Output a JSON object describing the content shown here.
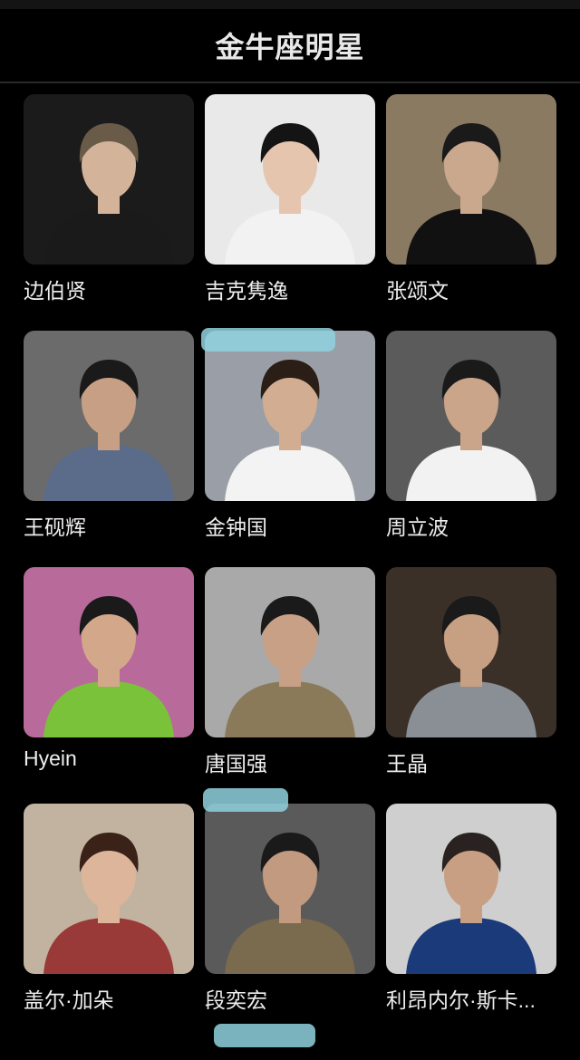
{
  "header": {
    "title": "金牛座明星"
  },
  "celebrities": [
    {
      "name": "边伯贤",
      "bg": "#1b1b1b",
      "skin": "#d3b39a",
      "hair": "#6a5b48",
      "top": "#1a1a1a"
    },
    {
      "name": "吉克隽逸",
      "bg": "#e9e9e9",
      "skin": "#e6c5ae",
      "hair": "#141414",
      "top": "#f2f2f2"
    },
    {
      "name": "张颂文",
      "bg": "#8a7a62",
      "skin": "#c9a88e",
      "hair": "#1a1a1a",
      "top": "#111111"
    },
    {
      "name": "王砚辉",
      "bg": "#6b6b6b",
      "skin": "#c79f84",
      "hair": "#1a1a1a",
      "top": "#5a6c8a"
    },
    {
      "name": "金钟国",
      "bg": "#9a9ea6",
      "skin": "#d2ad92",
      "hair": "#2a1e16",
      "top": "#f3f3f3"
    },
    {
      "name": "周立波",
      "bg": "#5b5b5b",
      "skin": "#caa58a",
      "hair": "#1a1a1a",
      "top": "#f2f2f2"
    },
    {
      "name": "Hyein",
      "bg": "#b86a9a",
      "skin": "#d3a88a",
      "hair": "#1a1a1a",
      "top": "#7ac23a"
    },
    {
      "name": "唐国强",
      "bg": "#a9a9a9",
      "skin": "#c8a085",
      "hair": "#1a1a1a",
      "top": "#8a7a5a"
    },
    {
      "name": "王晶",
      "bg": "#3a3028",
      "skin": "#c7a083",
      "hair": "#1a1a1a",
      "top": "#8a8f96"
    },
    {
      "name": "盖尔·加朵",
      "bg": "#c2b3a0",
      "skin": "#dcb59a",
      "hair": "#3a2218",
      "top": "#9a3a38"
    },
    {
      "name": "段奕宏",
      "bg": "#5a5a5a",
      "skin": "#c29a7f",
      "hair": "#1a1a1a",
      "top": "#7a6a4e"
    },
    {
      "name": "利昂内尔·斯卡...",
      "bg": "#cfcfd0",
      "skin": "#c89f82",
      "hair": "#2a2220",
      "top": "#1a3a7a"
    }
  ]
}
